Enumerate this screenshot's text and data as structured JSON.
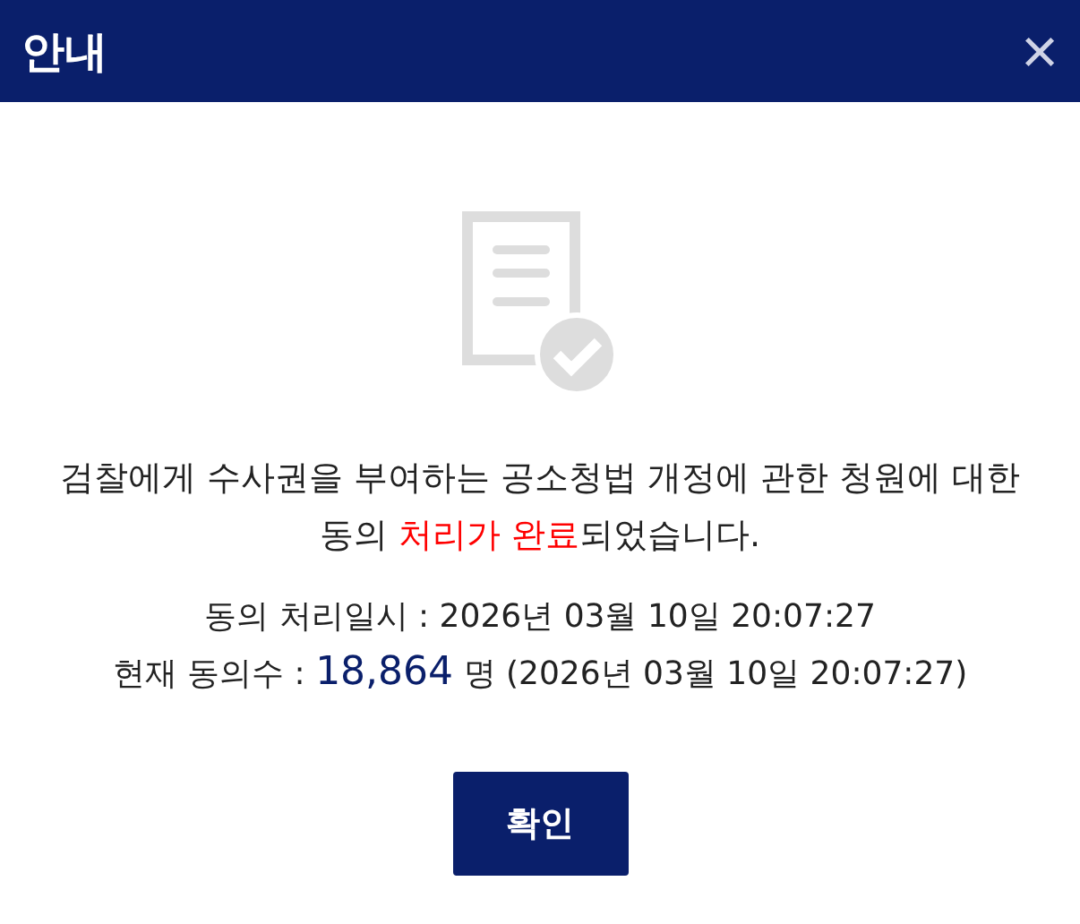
{
  "dialog": {
    "title": "안내",
    "close": "×"
  },
  "message": {
    "before": "검찰에게 수사권을 부여하는 공소청법 개정에 관한 청원에 대한 동의 ",
    "highlight": "처리가 완료",
    "after": "되었습니다."
  },
  "processed_time": "동의 처리일시 : 2026년 03월 10일 20:07:27",
  "agreement_count": {
    "label": "현재 동의수 : ",
    "value": "18,864",
    "suffix": " 명 (2026년 03월 10일 20:07:27)"
  },
  "button": "확인"
}
